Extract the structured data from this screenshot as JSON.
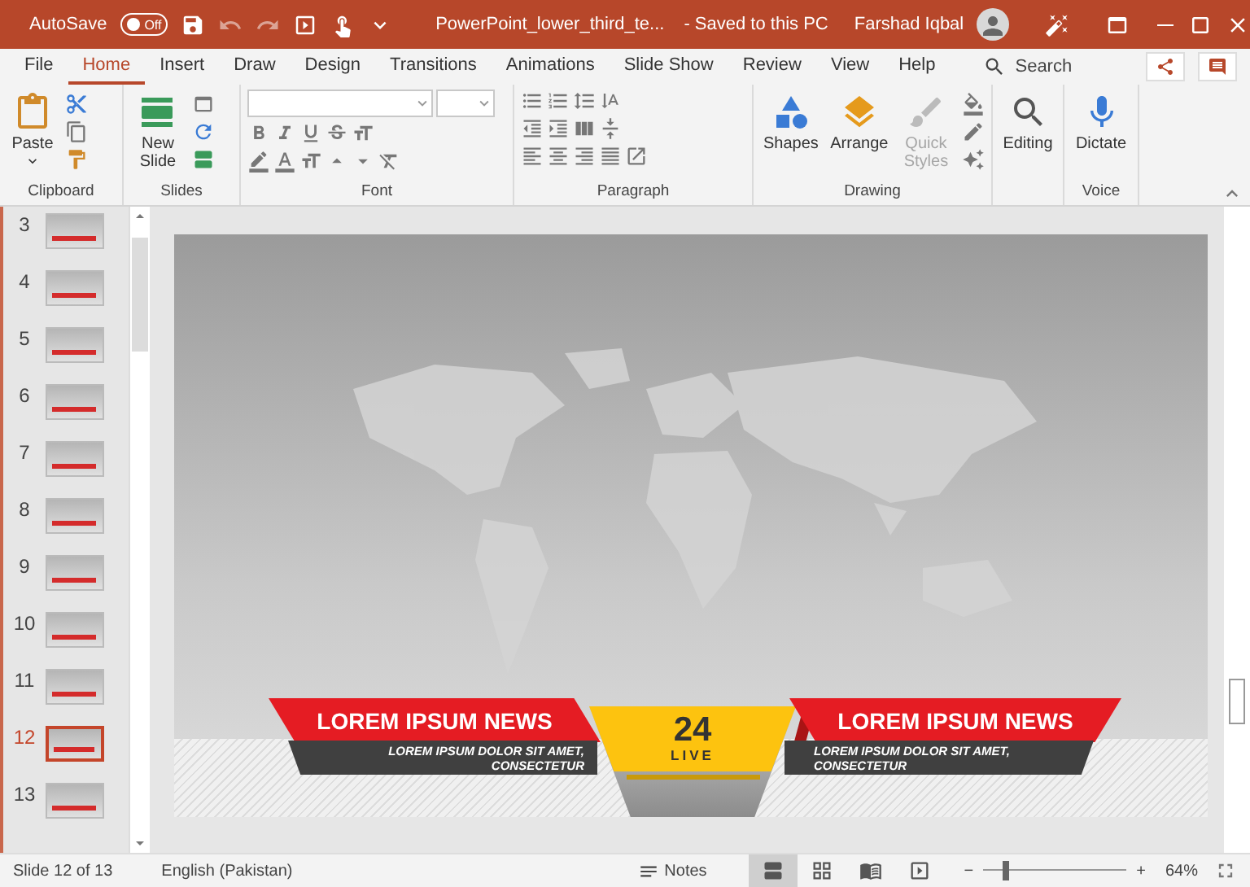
{
  "title_bar": {
    "autosave_label": "AutoSave",
    "autosave_toggle": {
      "label": "Off",
      "on": false
    },
    "file_name": "PowerPoint_lower_third_te...",
    "save_status": "-  Saved to this PC",
    "user_name": "Farshad Iqbal"
  },
  "tabs": [
    {
      "label": "File",
      "selected": false
    },
    {
      "label": "Home",
      "selected": true
    },
    {
      "label": "Insert",
      "selected": false
    },
    {
      "label": "Draw",
      "selected": false
    },
    {
      "label": "Design",
      "selected": false
    },
    {
      "label": "Transitions",
      "selected": false
    },
    {
      "label": "Animations",
      "selected": false
    },
    {
      "label": "Slide Show",
      "selected": false
    },
    {
      "label": "Review",
      "selected": false
    },
    {
      "label": "View",
      "selected": false
    },
    {
      "label": "Help",
      "selected": false
    }
  ],
  "search": {
    "placeholder": "Search"
  },
  "ribbon": {
    "clipboard": {
      "label": "Clipboard",
      "paste": "Paste"
    },
    "slides": {
      "label": "Slides",
      "new_slide": "New Slide"
    },
    "font": {
      "label": "Font"
    },
    "paragraph": {
      "label": "Paragraph"
    },
    "drawing": {
      "label": "Drawing",
      "buttons": [
        {
          "label": "Shapes",
          "disabled": false
        },
        {
          "label": "Arrange",
          "disabled": false
        },
        {
          "label": "Quick Styles",
          "disabled": true
        }
      ]
    },
    "editing": {
      "button": "Editing"
    },
    "voice": {
      "label": "Voice",
      "dictate": "Dictate"
    }
  },
  "thumbnails": [
    {
      "number": "3",
      "selected": false
    },
    {
      "number": "4",
      "selected": false
    },
    {
      "number": "5",
      "selected": false
    },
    {
      "number": "6",
      "selected": false
    },
    {
      "number": "7",
      "selected": false
    },
    {
      "number": "8",
      "selected": false
    },
    {
      "number": "9",
      "selected": false
    },
    {
      "number": "10",
      "selected": false
    },
    {
      "number": "11",
      "selected": false
    },
    {
      "number": "12",
      "selected": true
    },
    {
      "number": "13",
      "selected": false
    }
  ],
  "slide": {
    "left_headline": "LOREM IPSUM NEWS",
    "left_subline": "LOREM IPSUM DOLOR SIT AMET, CONSECTETUR",
    "channel_number": "24",
    "live_label": "LIVE",
    "right_headline": "LOREM IPSUM NEWS",
    "right_subline": "LOREM IPSUM DOLOR SIT AMET, CONSECTETUR"
  },
  "status_bar": {
    "slide_count": "Slide 12 of 13",
    "language": "English (Pakistan)",
    "notes": "Notes",
    "views": [
      {
        "kind": "normal",
        "selected": true
      },
      {
        "kind": "sorter",
        "selected": false
      },
      {
        "kind": "reading",
        "selected": false
      },
      {
        "kind": "slideshow",
        "selected": false
      }
    ],
    "zoom_out": "−",
    "zoom_in": "+",
    "zoom": {
      "level": 0.13
    },
    "zoom_percent": "64%"
  }
}
